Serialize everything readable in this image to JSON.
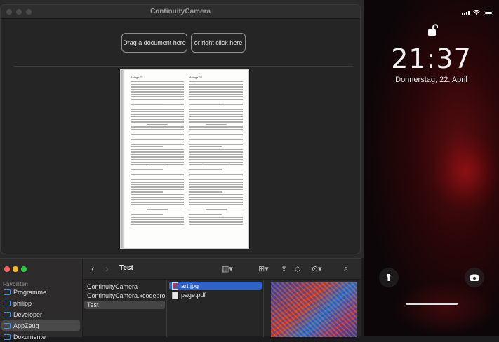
{
  "cc_window": {
    "title": "ContinuityCamera",
    "drag_label": "Drag a document here",
    "right_click_label": "or right click here",
    "document": {
      "left_header": "Anlage 21",
      "right_header": "Anlage 22"
    }
  },
  "phone": {
    "time": "21:37",
    "date": "Donnerstag, 22. April"
  },
  "finder": {
    "title": "Test",
    "favorites_header": "Favoriten",
    "sidebar": [
      {
        "label": "Programme"
      },
      {
        "label": "philipp"
      },
      {
        "label": "Developer"
      },
      {
        "label": "AppZeug"
      },
      {
        "label": "Dokumente"
      }
    ],
    "column1": [
      {
        "label": "ContinuityCamera"
      },
      {
        "label": "ContinuityCamera.xcodeproj"
      },
      {
        "label": "Test"
      }
    ],
    "column2": [
      {
        "label": "art.jpg"
      },
      {
        "label": "page.pdf"
      }
    ]
  },
  "colors": {
    "accent_blue": "#2f62c6",
    "traffic_red": "#ff5f57",
    "traffic_yellow": "#febc2e",
    "traffic_green": "#28c840"
  }
}
